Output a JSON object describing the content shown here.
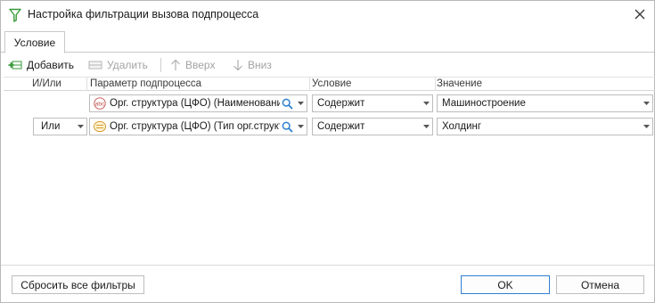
{
  "window": {
    "title": "Настройка фильтрации вызова подпроцесса"
  },
  "tabs": [
    {
      "label": "Условие"
    }
  ],
  "toolbar": {
    "add_label": "Добавить",
    "delete_label": "Удалить",
    "up_label": "Вверх",
    "down_label": "Вниз"
  },
  "grid": {
    "headers": {
      "andor": "И/Или",
      "parameter": "Параметр подпроцесса",
      "condition": "Условие",
      "value": "Значение"
    },
    "rows": [
      {
        "andor": "",
        "param_icon": "text-type-icon",
        "parameter": "Орг. структура (ЦФО) (Наименование)",
        "condition": "Содержит",
        "value": "Машиностроение"
      },
      {
        "andor": "Или",
        "param_icon": "reference-type-icon",
        "parameter": "Орг. структура (ЦФО) (Тип орг.структуры)",
        "condition": "Содержит",
        "value": "Холдинг"
      }
    ]
  },
  "footer": {
    "reset_label": "Сбросить все фильтры",
    "ok_label": "OK",
    "cancel_label": "Отмена"
  },
  "colors": {
    "accent": "#2d7fd0",
    "add_icon": "#3a9a3a",
    "filter_icon": "#3a9a3a"
  }
}
